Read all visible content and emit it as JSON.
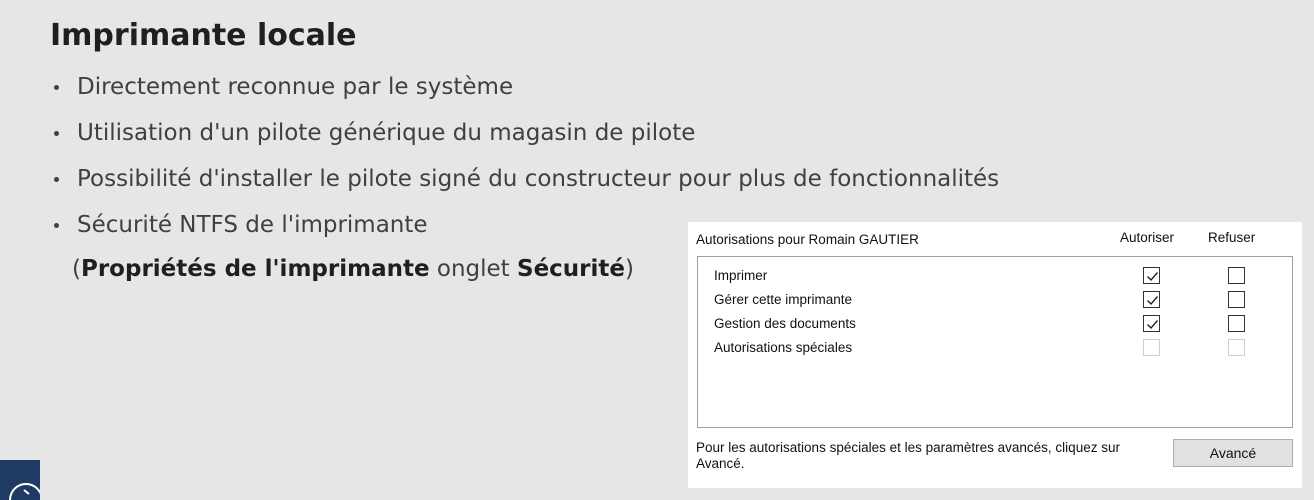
{
  "slide": {
    "title": "Imprimante locale",
    "bullets": [
      "Directement reconnue par le système",
      "Utilisation d'un pilote générique du magasin de pilote",
      "Possibilité d'installer le pilote signé du constructeur pour plus de fonctionnalités",
      "Sécurité NTFS de l'imprimante"
    ],
    "subline": {
      "open": "(",
      "bold1": "Propriétés de l'imprimante",
      "mid": " onglet ",
      "bold2": "Sécurité",
      "close": ")"
    }
  },
  "permissions": {
    "header": "Autorisations pour Romain GAUTIER",
    "col_allow": "Autoriser",
    "col_deny": "Refuser",
    "rows": [
      {
        "label": "Imprimer",
        "allow": true,
        "deny": false,
        "enabled": true
      },
      {
        "label": "Gérer cette imprimante",
        "allow": true,
        "deny": false,
        "enabled": true
      },
      {
        "label": "Gestion des documents",
        "allow": true,
        "deny": false,
        "enabled": true
      },
      {
        "label": "Autorisations spéciales",
        "allow": false,
        "deny": false,
        "enabled": false
      }
    ],
    "footer_text": "Pour les autorisations spéciales et les paramètres avancés, cliquez sur Avancé.",
    "advanced_button": "Avancé"
  },
  "icons": {
    "checkmark": "checkmark-icon",
    "corner": "navigation-icon"
  },
  "colors": {
    "background": "#e5e6e6",
    "corner_button": "#1f3b63"
  }
}
